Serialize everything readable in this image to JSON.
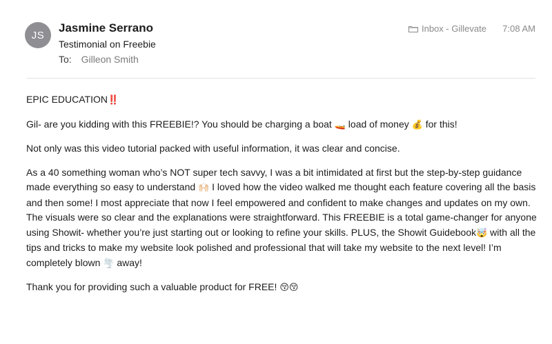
{
  "email": {
    "avatar_initials": "JS",
    "sender_name": "Jasmine Serrano",
    "subject": "Testimonial on Freebie",
    "to_label": "To:",
    "to_name": "Gilleon Smith",
    "mailbox": "Inbox - Gillevate",
    "time": "7:08 AM"
  },
  "body": {
    "p1_text": "EPIC EDUCATION",
    "p1_emoji": "‼️",
    "p2_a": "Gil- are you kidding with this FREEBIE!? You should be charging a boat ",
    "p2_emoji1": "🚤",
    "p2_b": " load of money ",
    "p2_emoji2": "💰",
    "p2_c": " for this!",
    "p3": "Not only was this video tutorial packed with useful information, it was clear and concise.",
    "p4_a": "As a 40 something woman who’s NOT super tech savvy, I was a bit intimidated at first but the step-by-step guidance made everything so easy to understand ",
    "p4_emoji1": "🙌🏻",
    "p4_b": " I loved how the video walked me thought each feature covering all the basis and then some!  I most appreciate that now I feel empowered and confident to make changes and updates on my own. The visuals were so clear and the explanations were straightforward. This FREEBIE is a total game-changer for anyone using Showit- whether you’re just starting out or looking to refine your skills. PLUS, the Showit Guidebook",
    "p4_emoji2": "🤯",
    "p4_c": " with all the tips and tricks to make my website look polished and professional that will take my website to the next level! I’m completely blown ",
    "p4_emoji3": "🌪️",
    "p4_d": " away!",
    "p5_a": "Thank you for providing such a valuable product for FREE! ",
    "p5_emoji": "😚😚"
  },
  "colors": {
    "avatar_bg": "#8e8e93",
    "accent_red": "#d9202a"
  }
}
